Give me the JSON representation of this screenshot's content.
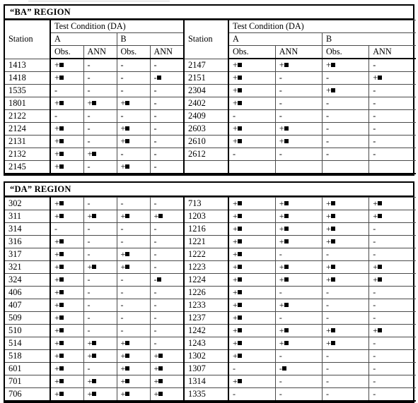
{
  "document": {
    "type": "results-table",
    "columns": [
      "Station",
      "Obs.",
      "ANN",
      "Obs.",
      "ANN"
    ],
    "header": {
      "station_label": "Station",
      "test_condition_label": "Test Condition (DA)",
      "condition_a": "A",
      "condition_b": "B",
      "obs_label": "Obs.",
      "ann_label": "ANN"
    },
    "marks": {
      "plus_square": "+■",
      "minus_square": "-■",
      "minus": "-",
      "blank": ""
    }
  },
  "regions": [
    {
      "title": "“BA”  REGION",
      "left": {
        "rows": [
          {
            "station": "1413",
            "cells": [
              "plus_square",
              "minus",
              "minus",
              "minus"
            ]
          },
          {
            "station": "1418",
            "cells": [
              "plus_square",
              "minus",
              "minus",
              "minus_square"
            ]
          },
          {
            "station": "1535",
            "cells": [
              "minus",
              "minus",
              "minus",
              "minus"
            ]
          },
          {
            "station": "1801",
            "cells": [
              "plus_square",
              "plus_square",
              "plus_square",
              "minus"
            ]
          },
          {
            "station": "2122",
            "cells": [
              "minus",
              "minus",
              "minus",
              "minus"
            ]
          },
          {
            "station": "2124",
            "cells": [
              "plus_square",
              "minus",
              "plus_square",
              "minus"
            ]
          },
          {
            "station": "2131",
            "cells": [
              "plus_square",
              "minus",
              "plus_square",
              "minus"
            ]
          },
          {
            "station": "2132",
            "cells": [
              "plus_square",
              "plus_square",
              "minus",
              "minus"
            ]
          },
          {
            "station": "2145",
            "cells": [
              "plus_square",
              "minus",
              "plus_square",
              "minus"
            ]
          }
        ]
      },
      "right": {
        "rows": [
          {
            "station": "2147",
            "cells": [
              "plus_square",
              "plus_square",
              "plus_square",
              "minus"
            ]
          },
          {
            "station": "2151",
            "cells": [
              "plus_square",
              "minus",
              "minus",
              "plus_square"
            ]
          },
          {
            "station": "2304",
            "cells": [
              "plus_square",
              "minus",
              "plus_square",
              "minus"
            ]
          },
          {
            "station": "2402",
            "cells": [
              "plus_square",
              "minus",
              "minus",
              "minus"
            ]
          },
          {
            "station": "2409",
            "cells": [
              "minus",
              "minus",
              "minus",
              "minus"
            ]
          },
          {
            "station": "2603",
            "cells": [
              "plus_square",
              "plus_square",
              "minus",
              "minus"
            ]
          },
          {
            "station": "2610",
            "cells": [
              "plus_square",
              "plus_square",
              "minus",
              "minus"
            ]
          },
          {
            "station": "2612",
            "cells": [
              "minus",
              "minus",
              "minus",
              "minus"
            ]
          },
          {
            "station": "",
            "cells": [
              "blank",
              "blank",
              "blank",
              "blank"
            ]
          }
        ]
      }
    },
    {
      "title": "“DA” REGION",
      "left": {
        "rows": [
          {
            "station": "302",
            "cells": [
              "plus_square",
              "minus",
              "minus",
              "minus"
            ]
          },
          {
            "station": "311",
            "cells": [
              "plus_square",
              "plus_square",
              "plus_square",
              "plus_square"
            ]
          },
          {
            "station": "314",
            "cells": [
              "minus",
              "minus",
              "minus",
              "minus"
            ]
          },
          {
            "station": "316",
            "cells": [
              "plus_square",
              "minus",
              "minus",
              "minus"
            ]
          },
          {
            "station": "317",
            "cells": [
              "plus_square",
              "minus",
              "plus_square",
              "minus"
            ]
          },
          {
            "station": "321",
            "cells": [
              "plus_square",
              "plus_square",
              "plus_square",
              "minus"
            ]
          },
          {
            "station": "324",
            "cells": [
              "plus_square",
              "minus",
              "minus",
              "minus_square"
            ]
          },
          {
            "station": "406",
            "cells": [
              "plus_square",
              "minus",
              "minus",
              "minus"
            ]
          },
          {
            "station": "407",
            "cells": [
              "plus_square",
              "minus",
              "minus",
              "minus"
            ]
          },
          {
            "station": "509",
            "cells": [
              "plus_square",
              "minus",
              "minus",
              "minus"
            ]
          },
          {
            "station": "510",
            "cells": [
              "plus_square",
              "minus",
              "minus",
              "minus"
            ]
          },
          {
            "station": "514",
            "cells": [
              "plus_square",
              "plus_square",
              "plus_square",
              "minus"
            ]
          },
          {
            "station": "518",
            "cells": [
              "plus_square",
              "plus_square",
              "plus_square",
              "plus_square"
            ]
          },
          {
            "station": "601",
            "cells": [
              "plus_square",
              "minus",
              "plus_square",
              "plus_square"
            ]
          },
          {
            "station": "701",
            "cells": [
              "plus_square",
              "plus_square",
              "plus_square",
              "plus_square"
            ]
          },
          {
            "station": "706",
            "cells": [
              "plus_square",
              "plus_square",
              "plus_square",
              "plus_square"
            ]
          }
        ]
      },
      "right": {
        "rows": [
          {
            "station": "713",
            "cells": [
              "plus_square",
              "plus_square",
              "plus_square",
              "plus_square"
            ]
          },
          {
            "station": "1203",
            "cells": [
              "plus_square",
              "plus_square",
              "plus_square",
              "plus_square"
            ]
          },
          {
            "station": "1216",
            "cells": [
              "plus_square",
              "plus_square",
              "plus_square",
              "minus"
            ]
          },
          {
            "station": "1221",
            "cells": [
              "plus_square",
              "plus_square",
              "plus_square",
              "minus"
            ]
          },
          {
            "station": "1222",
            "cells": [
              "plus_square",
              "minus",
              "minus",
              "minus"
            ]
          },
          {
            "station": "1223",
            "cells": [
              "plus_square",
              "plus_square",
              "plus_square",
              "plus_square"
            ]
          },
          {
            "station": "1224",
            "cells": [
              "plus_square",
              "plus_square",
              "plus_square",
              "plus_square"
            ]
          },
          {
            "station": "1226",
            "cells": [
              "plus_square",
              "minus",
              "minus",
              "minus"
            ]
          },
          {
            "station": "1233",
            "cells": [
              "plus_square",
              "plus_square",
              "minus",
              "minus"
            ]
          },
          {
            "station": "1237",
            "cells": [
              "plus_square",
              "minus",
              "minus",
              "minus"
            ]
          },
          {
            "station": "1242",
            "cells": [
              "plus_square",
              "plus_square",
              "plus_square",
              "plus_square"
            ]
          },
          {
            "station": "1243",
            "cells": [
              "plus_square",
              "plus_square",
              "plus_square",
              "minus"
            ]
          },
          {
            "station": "1302",
            "cells": [
              "plus_square",
              "minus",
              "minus",
              "minus"
            ]
          },
          {
            "station": "1307",
            "cells": [
              "minus",
              "minus_square",
              "minus",
              "minus"
            ]
          },
          {
            "station": "1314",
            "cells": [
              "plus_square",
              "minus",
              "minus",
              "minus"
            ]
          },
          {
            "station": "1335",
            "cells": [
              "minus",
              "minus",
              "minus",
              "minus"
            ]
          }
        ]
      }
    }
  ]
}
